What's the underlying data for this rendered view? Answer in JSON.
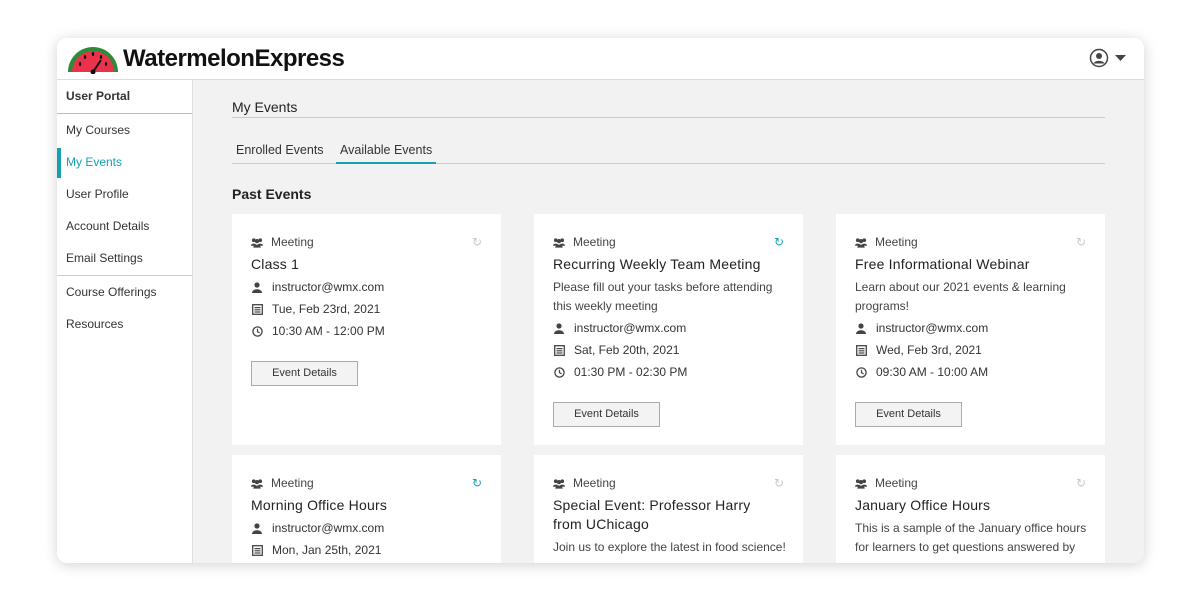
{
  "app": {
    "brand": "WatermelonExpress"
  },
  "sidebar": {
    "header": "User Portal",
    "items": [
      {
        "label": "My Courses"
      },
      {
        "label": "My Events"
      },
      {
        "label": "User Profile"
      },
      {
        "label": "Account Details"
      },
      {
        "label": "Email Settings"
      },
      {
        "label": "Course Offerings"
      },
      {
        "label": "Resources"
      }
    ],
    "active_item": "My Events"
  },
  "main": {
    "title": "My Events",
    "tabs": [
      {
        "label": "Enrolled Events"
      },
      {
        "label": "Available Events"
      }
    ],
    "active_tab": "Available Events",
    "section_title": "Past Events"
  },
  "events": [
    {
      "type": "Meeting",
      "title": "Class 1",
      "email": "instructor@wmx.com",
      "date": "Tue, Feb 23rd, 2021",
      "time": "10:30 AM - 12:00 PM",
      "recurring": false,
      "button": "Event Details"
    },
    {
      "type": "Meeting",
      "title": "Recurring Weekly Team Meeting",
      "description": "Please fill out your tasks before attending this weekly meeting",
      "email": "instructor@wmx.com",
      "date": "Sat, Feb 20th, 2021",
      "time": "01:30 PM - 02:30 PM",
      "recurring": true,
      "button": "Event Details"
    },
    {
      "type": "Meeting",
      "title": "Free Informational Webinar",
      "description": "Learn about our 2021 events & learning programs!",
      "email": "instructor@wmx.com",
      "date": "Wed, Feb 3rd, 2021",
      "time": "09:30 AM - 10:00 AM",
      "recurring": false,
      "button": "Event Details"
    },
    {
      "type": "Meeting",
      "title": "Morning Office Hours",
      "email": "instructor@wmx.com",
      "date": "Mon, Jan 25th, 2021",
      "recurring": true
    },
    {
      "type": "Meeting",
      "title": "Special Event: Professor Harry from UChicago",
      "description": "Join us to explore the latest in food science!",
      "recurring": false
    },
    {
      "type": "Meeting",
      "title": "January Office Hours",
      "description": "This is a sample of the January office hours for learners to get questions answered by",
      "recurring": false
    }
  ],
  "colors": {
    "accent": "#17a0b4",
    "watermelon_rind": "#2e8b3a",
    "watermelon_flesh": "#e8334a"
  },
  "icons": {
    "type": "users-icon",
    "refresh": "refresh-icon",
    "email": "user-icon",
    "date": "calendar-icon",
    "time": "clock-icon",
    "account": "account-circle-icon"
  }
}
